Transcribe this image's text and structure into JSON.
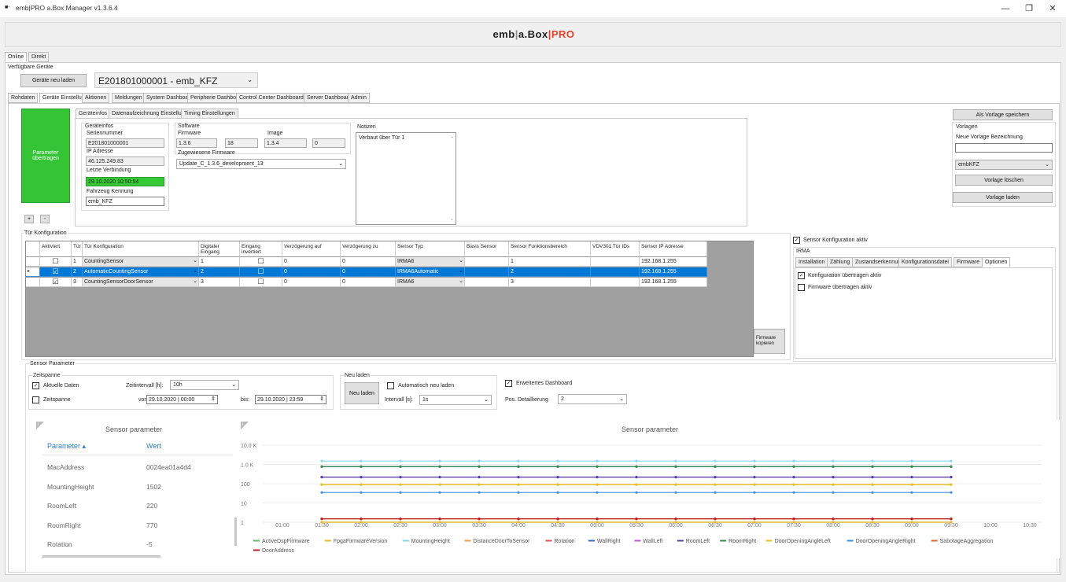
{
  "window": {
    "title": "emb|PRO a.Box Manager v1.3.6.4",
    "minimize": "—",
    "restore": "❐",
    "close": "✕"
  },
  "logo": {
    "a": "emb",
    "b": "|",
    "c": "a.Box",
    "d": "|",
    "e": "PRO"
  },
  "top_tabs": [
    "Online",
    "Direkt"
  ],
  "devices": {
    "label": "Verfügbare Geräte",
    "reload": "Geräte neu laden",
    "selected": "E201801000001 - emb_KFZ"
  },
  "main_tabs": [
    "Rohdaten",
    "Geräte Einstellungen",
    "Aktionen",
    "Meldungen",
    "System Dashboard",
    "Peripherie Dashboard",
    "Control Center Dashboard",
    "Server Dashboard",
    "Admin"
  ],
  "sub_tabs": [
    "Geräteinfos",
    "Datenaufzeichnung Einstellungen",
    "Timing Einstellungen"
  ],
  "transfer_btn": "Parameter übertragen",
  "info": {
    "group": "Geräteinfos",
    "serial_label": "Seriennummer",
    "serial": "E201801000001",
    "ip_label": "IP Adresse",
    "ip": "46.125.249.83",
    "last_label": "Letzte Verbindung",
    "last": "29.10.2020 10:50:54",
    "vehicle_label": "Fahrzeug Kennung",
    "vehicle": "emb_KFZ"
  },
  "software": {
    "group": "Software",
    "fw_label": "Firmware",
    "fw1": "1.3.6",
    "fw2": "18",
    "image_label": "Image",
    "img1": "1.3.4",
    "img2": "0",
    "assigned_label": "Zugewiesene Firmware",
    "assigned": "Update_C_1.3.6_development_13"
  },
  "notes": {
    "group": "Notizen",
    "text": "Verbaut über Tür 1"
  },
  "templates": {
    "save": "Als Vorlage speichern",
    "group": "Vorlagen",
    "new_label": "Neue Vorlage Bezeichnung",
    "selected": "embKFZ",
    "delete": "Vorlage löschen",
    "load": "Vorlage laden"
  },
  "plusminus": [
    "+",
    "-"
  ],
  "door": {
    "group": "Tür Konfiguration",
    "headers": [
      "Aktiviert",
      "Tür",
      "Tür Konfiguration",
      "Digitaler Eingang",
      "Eingang invertiert",
      "Verzögerung auf",
      "Verzögerung zu",
      "Sensor Typ",
      "Basis Sensor",
      "Sensor Funktionsbereich",
      "VDV301 Tür IDs",
      "Sensor IP Adresse"
    ],
    "rows": [
      {
        "active": "☐",
        "door": "1",
        "config": "CountingSensor",
        "digital": "1",
        "inv": "☐",
        "up": "0",
        "down": "0",
        "type": "IRMA6",
        "base": "",
        "range": "1",
        "vdv": "",
        "ip": "192.168.1.255"
      },
      {
        "active": "☑",
        "door": "2",
        "config": "AutomaticCountingSensor",
        "digital": "2",
        "inv": "☐",
        "up": "0",
        "down": "0",
        "type": "IRMA6Automatic",
        "base": "",
        "range": "2",
        "vdv": "",
        "ip": "192.168.1.255"
      },
      {
        "active": "☑",
        "door": "3",
        "config": "CountingSensorDoorSensor",
        "digital": "3",
        "inv": "☐",
        "up": "0",
        "down": "0",
        "type": "IRMA6",
        "base": "",
        "range": "3",
        "vdv": "",
        "ip": "192.168.1.255"
      }
    ],
    "row_marker": "▸"
  },
  "fw_copy": "Firmware kopieren",
  "irma": {
    "active_label": "Sensor Konfiguration aktiv",
    "group": "IRMA",
    "tabs": [
      "Installation",
      "Zählung",
      "Zustandserkennung",
      "Konfigurationsdatei",
      "Firmware",
      "Optionen"
    ],
    "opt1": "Konfiguration übertragen aktiv",
    "opt2": "Firmware übertragen aktiv"
  },
  "sensor": {
    "group": "Sensor Parameter",
    "span_group": "Zeitspanne",
    "current": "Aktuelle Daten",
    "span": "Zeitspanne",
    "interval_label": "Zeitintervall [h]:",
    "interval": "10h",
    "from_label": "von:",
    "from": "29.10.2020 | 00:00",
    "to_label": "bis:",
    "to": "29.10.2020 | 23:59",
    "reload_group": "Neu laden",
    "reload_btn": "Neu laden",
    "auto": "Automatisch neu laden",
    "int_label": "Intervall [s]:",
    "int": "1s",
    "ext": "Erweitertes Dashboard",
    "pos_label": "Pos. Detaillierung",
    "pos": "2"
  },
  "table": {
    "title": "Sensor parameter",
    "col1": "Parameter ▴",
    "col2": "Wert",
    "rows": [
      [
        "MacAddress",
        "0024ea01a4d4"
      ],
      [
        "MountingHeight",
        "1502"
      ],
      [
        "RoomLeft",
        "220"
      ],
      [
        "RoomRight",
        "770"
      ],
      [
        "Rotation",
        "-5"
      ]
    ]
  },
  "chart_data": {
    "type": "line",
    "title": "Sensor parameter",
    "y_scale": "log",
    "ylim": [
      1,
      10000
    ],
    "y_ticks": [
      "10.0 K",
      "1.0 K",
      "100",
      "10",
      "1"
    ],
    "x": [
      "01:30",
      "02:00",
      "02:30",
      "03:00",
      "03:30",
      "04:00",
      "04:30",
      "05:00",
      "05:30",
      "06:00",
      "06:30",
      "07:00",
      "07:30",
      "08:00",
      "08:30",
      "09:00",
      "09:30"
    ],
    "x_ticks": [
      "01:00",
      "01:30",
      "02:00",
      "02:30",
      "03:00",
      "03:30",
      "04:00",
      "04:30",
      "05:00",
      "05:30",
      "06:00",
      "06:30",
      "07:00",
      "07:30",
      "08:00",
      "08:30",
      "09:00",
      "09:30",
      "10:00",
      "10:30"
    ],
    "series": [
      {
        "name": "ActiveDspFirmware",
        "color": "#66bb6a",
        "value": 1
      },
      {
        "name": "FpgaFirmwareVersion",
        "color": "#f0b429",
        "value": 1
      },
      {
        "name": "MountingHeight",
        "color": "#80d8f0",
        "value": 1502
      },
      {
        "name": "DistanceDoorToSensor",
        "color": "#f59a42",
        "value": 90
      },
      {
        "name": "Rotation",
        "color": "#e55353",
        "value": 1.5
      },
      {
        "name": "WallRight",
        "color": "#2d6fc9",
        "value": 770
      },
      {
        "name": "WallLeft",
        "color": "#c454d6",
        "value": 220
      },
      {
        "name": "RoomLeft",
        "color": "#5b3fa8",
        "value": 220
      },
      {
        "name": "RoomRight",
        "color": "#3d8b4a",
        "value": 770
      },
      {
        "name": "DoorOpeningAngleLeft",
        "color": "#e8c21a",
        "value": 90
      },
      {
        "name": "DoorOpeningAngleRight",
        "color": "#3e8ee0",
        "value": 35
      },
      {
        "name": "SabotageAggregation",
        "color": "#e0662e",
        "value": 1.5
      },
      {
        "name": "DoorAddress",
        "color": "#b32020",
        "value": 1.5
      }
    ]
  }
}
